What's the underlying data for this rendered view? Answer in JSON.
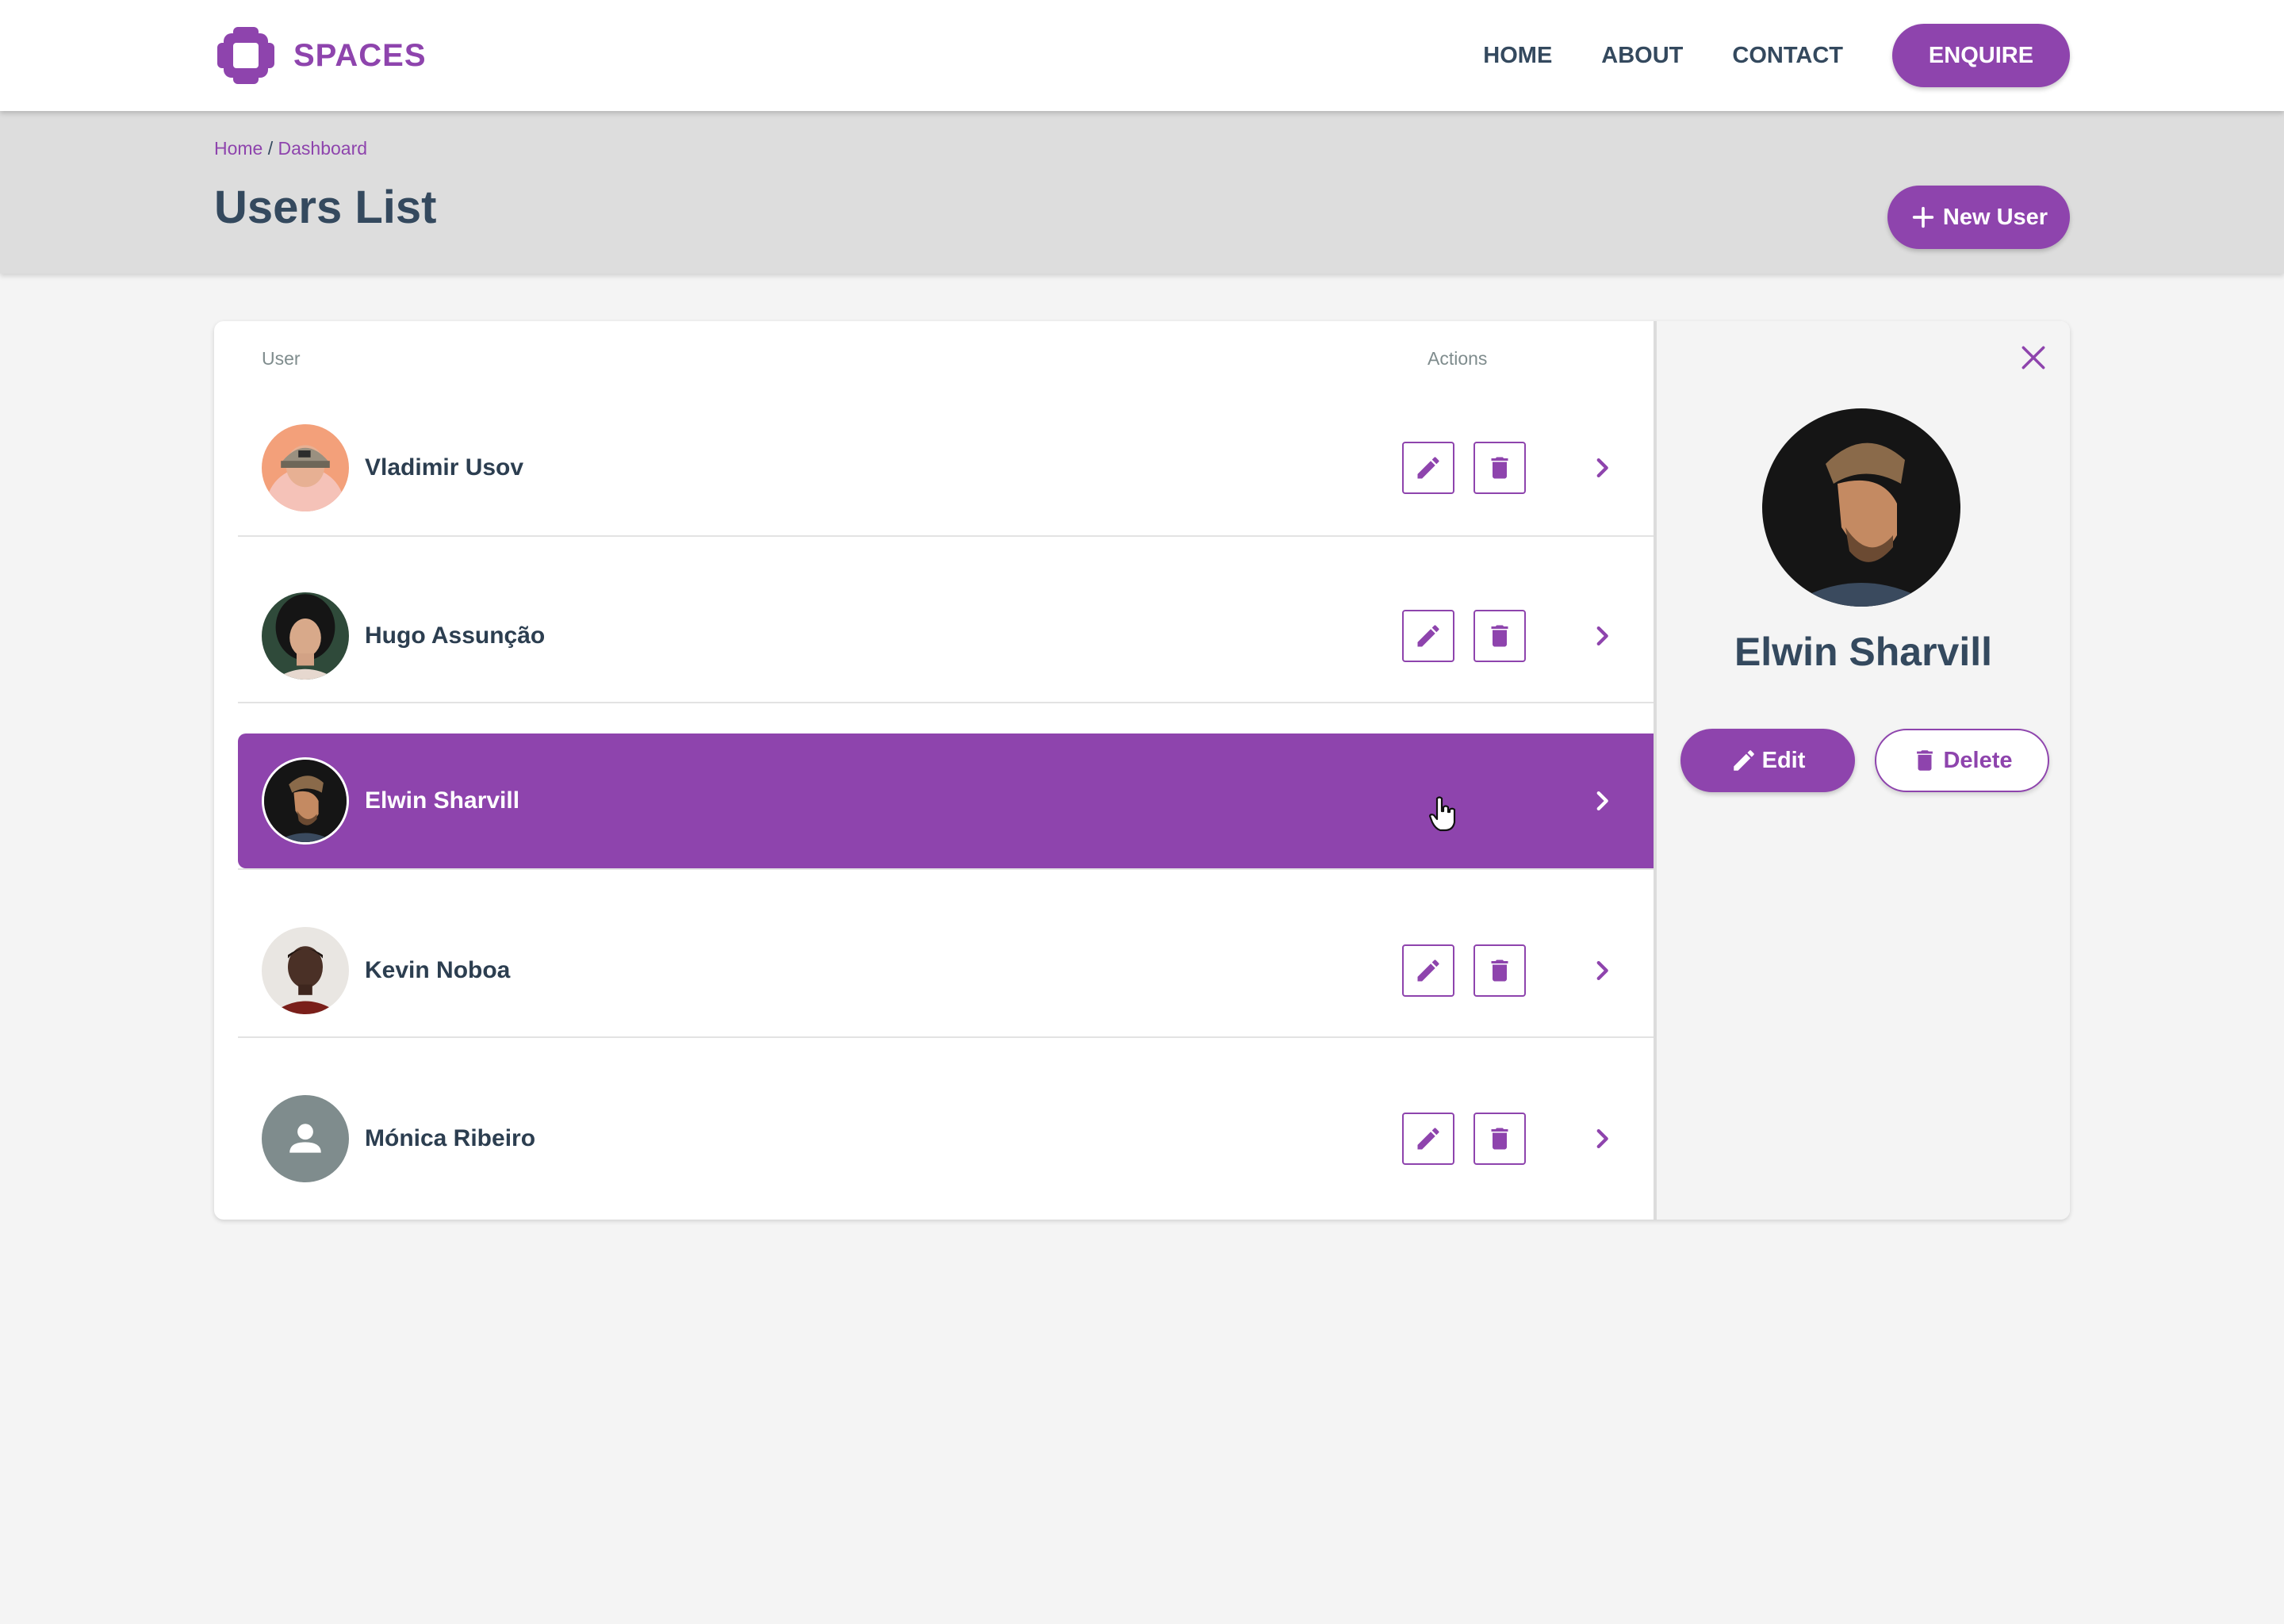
{
  "colors": {
    "accent": "#8e44ad",
    "text_dark": "#34495e",
    "header_band": "#dddddd",
    "page_bg": "#f4f4f4"
  },
  "navbar": {
    "brand": "SPACES",
    "logo_icon": "puzzle-cross-icon",
    "links": [
      "HOME",
      "ABOUT",
      "CONTACT"
    ],
    "cta": "ENQUIRE"
  },
  "page": {
    "breadcrumb": {
      "home": "Home",
      "separator": "/",
      "current": "Dashboard"
    },
    "title": "Users List",
    "new_user_label": "New User"
  },
  "table": {
    "columns": {
      "user": "User",
      "actions": "Actions"
    },
    "rows": [
      {
        "name": "Vladimir Usov",
        "avatar": "photo",
        "selected": false
      },
      {
        "name": "Hugo Assunção",
        "avatar": "photo",
        "selected": false
      },
      {
        "name": "Elwin Sharvill",
        "avatar": "photo",
        "selected": true
      },
      {
        "name": "Kevin Noboa",
        "avatar": "photo",
        "selected": false
      },
      {
        "name": "Mónica Ribeiro",
        "avatar": "placeholder-person-icon",
        "selected": false
      }
    ]
  },
  "detail": {
    "name": "Elwin Sharvill",
    "edit_label": "Edit",
    "delete_label": "Delete",
    "close_icon": "close-icon"
  }
}
